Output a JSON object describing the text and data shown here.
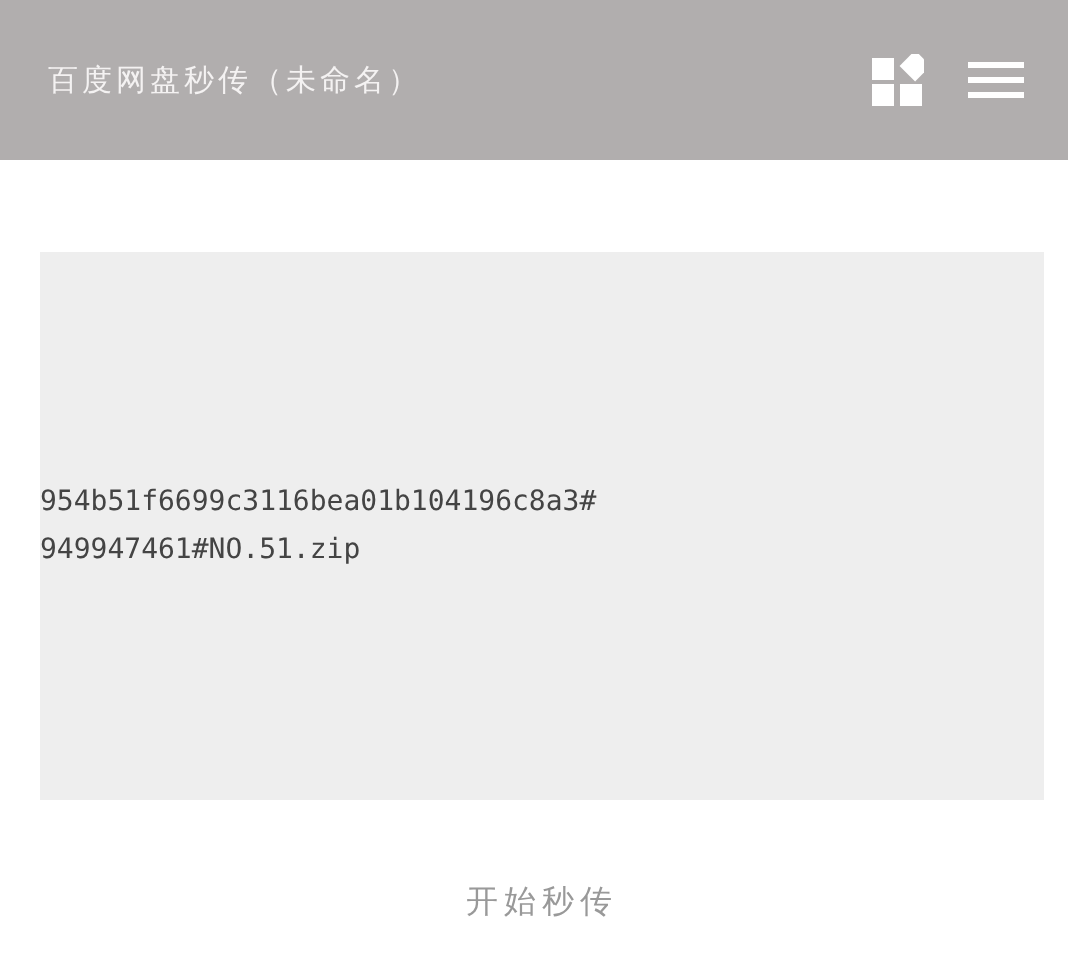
{
  "header": {
    "title": "百度网盘秒传（未命名）"
  },
  "link_field": {
    "value": "954b51f6699c3116bea01b104196c8a3#949947461#NO.51.zip"
  },
  "start_button": {
    "label": "开始秒传"
  }
}
